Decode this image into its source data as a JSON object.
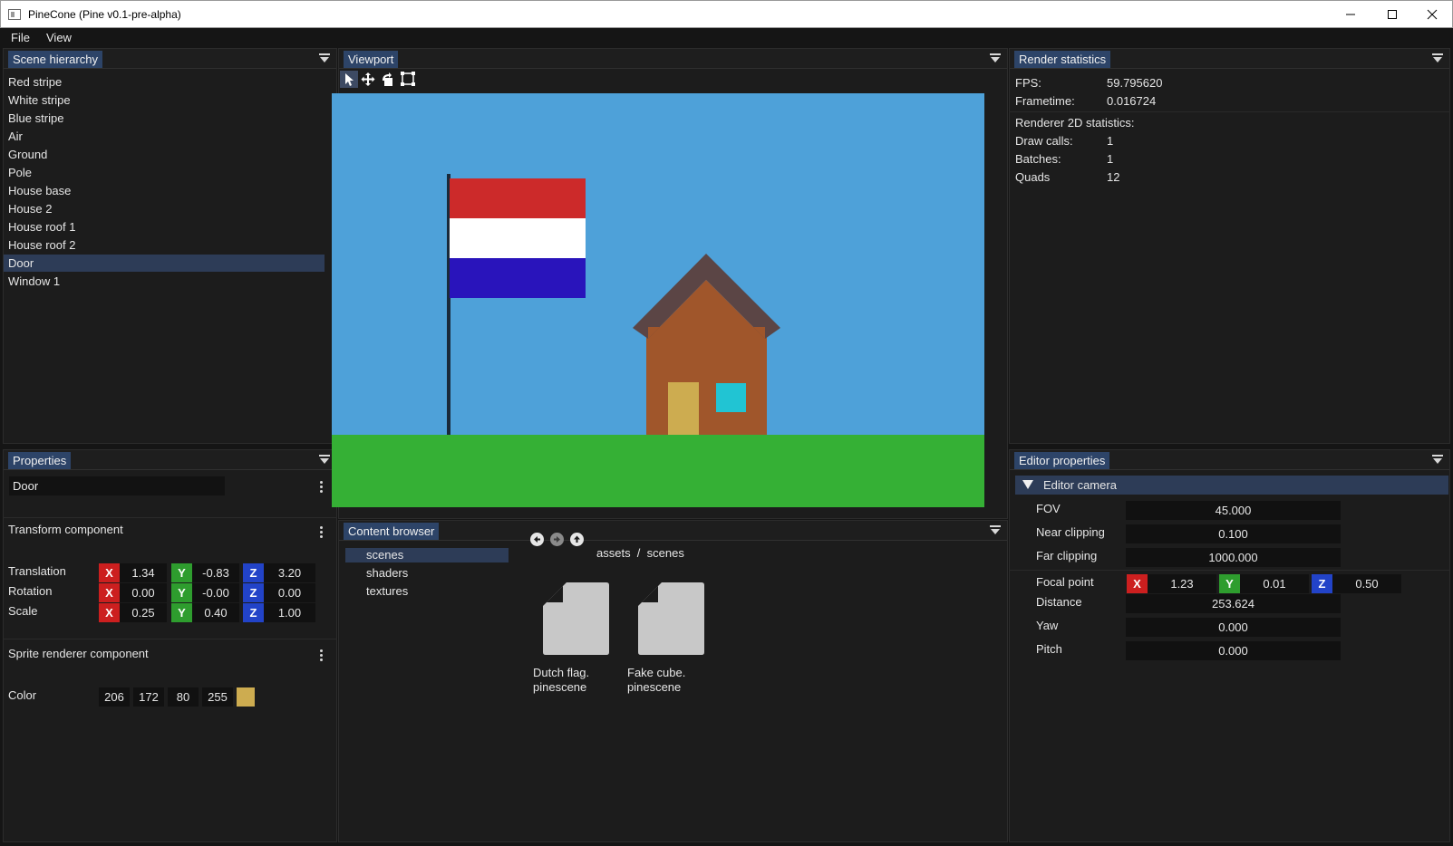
{
  "window": {
    "title": "PineCone (Pine v0.1-pre-alpha)"
  },
  "menu": [
    "File",
    "View"
  ],
  "scene_hierarchy": {
    "title": "Scene hierarchy",
    "items": [
      {
        "label": "Red stripe"
      },
      {
        "label": "White stripe"
      },
      {
        "label": "Blue stripe"
      },
      {
        "label": "Air"
      },
      {
        "label": "Ground"
      },
      {
        "label": "Pole"
      },
      {
        "label": "House base"
      },
      {
        "label": "House 2"
      },
      {
        "label": "House roof 1"
      },
      {
        "label": "House roof 2"
      },
      {
        "label": "Door",
        "selected": true
      },
      {
        "label": "Window 1"
      }
    ]
  },
  "properties": {
    "title": "Properties",
    "entity_name": "Door",
    "transform": {
      "title": "Transform component",
      "rows": [
        {
          "label": "Translation",
          "x": "1.34",
          "y": "-0.83",
          "z": "3.20"
        },
        {
          "label": "Rotation",
          "x": "0.00",
          "y": "-0.00",
          "z": "0.00"
        },
        {
          "label": "Scale",
          "x": "0.25",
          "y": "0.40",
          "z": "1.00"
        }
      ]
    },
    "sprite": {
      "title": "Sprite renderer component",
      "color_label": "Color",
      "rgba": [
        "206",
        "172",
        "80",
        "255"
      ],
      "swatch": "#cdac50"
    },
    "axes": {
      "x": "X",
      "y": "Y",
      "z": "Z"
    }
  },
  "viewport": {
    "title": "Viewport",
    "tools": [
      "select-tool-icon",
      "move-tool-icon",
      "rotate-tool-icon",
      "scale-tool-icon"
    ],
    "colors": {
      "sky": "#4ea1d9",
      "ground": "#35b035",
      "flag_red": "#cc2a2a",
      "flag_white": "#ffffff",
      "flag_blue": "#2914bb",
      "pole": "#1a2a3a",
      "roof": "#5b4545",
      "house": "#a0562b",
      "door": "#cdac50",
      "window": "#21c4d3"
    }
  },
  "content_browser": {
    "title": "Content browser",
    "folders": [
      {
        "label": "scenes",
        "selected": true
      },
      {
        "label": "shaders"
      },
      {
        "label": "textures"
      }
    ],
    "path": "assets  /  scenes",
    "files": [
      {
        "line1": "Dutch flag.",
        "line2": "pinescene"
      },
      {
        "line1": "Fake cube.",
        "line2": "pinescene"
      }
    ]
  },
  "render_statistics": {
    "title": "Render statistics",
    "fps_label": "FPS:",
    "fps": "59.795620",
    "frametime_label": "Frametime:",
    "frametime": "0.016724",
    "renderer_title": "Renderer 2D statistics:",
    "draw_calls_label": "Draw calls:",
    "draw_calls": "1",
    "batches_label": "Batches:",
    "batches": "1",
    "quads_label": "Quads",
    "quads": "12"
  },
  "editor_properties": {
    "title": "Editor properties",
    "section": "Editor camera",
    "fov_label": "FOV",
    "fov": "45.000",
    "near_label": "Near clipping",
    "near": "0.100",
    "far_label": "Far clipping",
    "far": "1000.000",
    "focal_label": "Focal point",
    "focal": {
      "x": "1.23",
      "y": "0.01",
      "z": "0.50"
    },
    "distance_label": "Distance",
    "distance": "253.624",
    "yaw_label": "Yaw",
    "yaw": "0.000",
    "pitch_label": "Pitch",
    "pitch": "0.000"
  }
}
